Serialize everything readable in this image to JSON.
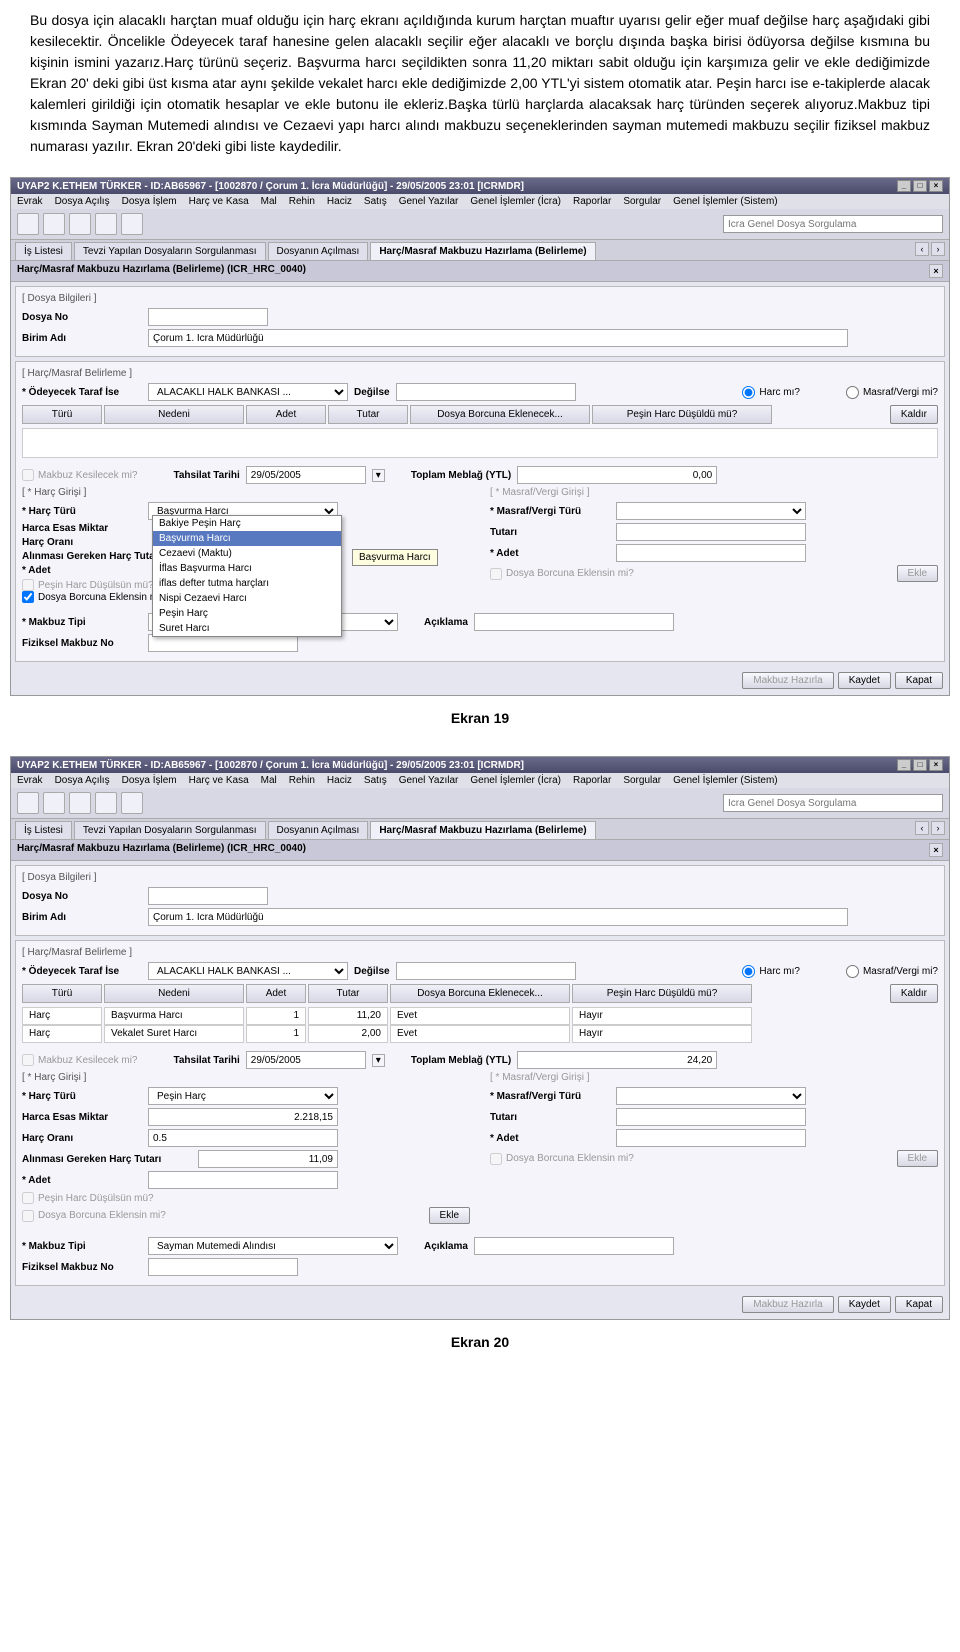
{
  "paragraph": "Bu dosya için alacaklı harçtan muaf olduğu için harç ekranı açıldığında kurum harçtan muaftır uyarısı gelir eğer muaf değilse harç aşağıdaki gibi kesilecektir. Öncelikle Ödeyecek taraf hanesine gelen alacaklı seçilir eğer alacaklı ve borçlu dışında başka birisi ödüyorsa değilse kısmına bu kişinin ismini yazarız.Harç türünü seçeriz. Başvurma harcı seçildikten sonra 11,20 miktarı sabit olduğu için karşımıza gelir ve ekle dediğimizde Ekran 20' deki gibi üst kısma atar aynı şekilde vekalet harcı ekle dediğimizde 2,00 YTL'yi sistem otomatik atar. Peşin harcı ise e-takiplerde alacak kalemleri girildiği için otomatik hesaplar ve ekle butonu ile ekleriz.Başka türlü harçlarda alacaksak harç türünden seçerek alıyoruz.Makbuz tipi kısmında Sayman Mutemedi alındısı ve Cezaevi yapı harcı alındı makbuzu seçeneklerinden sayman mutemedi makbuzu seçilir fiziksel makbuz numarası yazılır. Ekran 20'deki gibi liste kaydedilir.",
  "titlebar": "UYAP2  K.ETHEM TÜRKER - ID:AB65967 - [1002870 / Çorum 1. İcra Müdürlüğü] - 29/05/2005 23:01 [ICRMDR]",
  "menus": [
    "Evrak",
    "Dosya Açılış",
    "Dosya İşlem",
    "Harç ve Kasa",
    "Mal",
    "Rehin",
    "Haciz",
    "Satış",
    "Genel Yazılar",
    "Genel İşlemler (İcra)",
    "Raporlar",
    "Sorgular",
    "Genel İşlemler (Sistem)"
  ],
  "searchPlaceholder": "İcra Genel Dosya Sorgulama",
  "tabs": [
    "İş Listesi",
    "Tevzi Yapılan Dosyaların Sorgulanması",
    "Dosyanın Açılması",
    "Harç/Masraf Makbuzu Hazırlama (Belirleme)"
  ],
  "activeTab": 3,
  "subtitle": "Harç/Masraf Makbuzu Hazırlama (Belirleme) (ICR_HRC_0040)",
  "dosyaBilgileri": {
    "title": "[ Dosya Bilgileri ]",
    "dosyaNoLabel": "Dosya No",
    "birimAdiLabel": "Birim Adı",
    "birimAdi": "Çorum 1. İcra Müdürlüğü"
  },
  "harcBelirleme": {
    "title": "[ Harç/Masraf Belirleme ]",
    "odeyecekLabel": "* Ödeyecek Taraf İse",
    "odeyecekValue": "ALACAKLI HALK BANKASI ...",
    "degilseLabel": "Değilse",
    "harcMi": "Harc mı?",
    "masrafMi": "Masraf/Vergi mi?",
    "headers": [
      "Türü",
      "Nedeni",
      "Adet",
      "Tutar",
      "Dosya Borcuna Eklenecek...",
      "Peşin Harc Düşüldü mü?"
    ],
    "kaldirBtn": "Kaldır"
  },
  "tahsilat": {
    "makbuzKesilecek": "Makbuz Kesilecek mi?",
    "tahsilatTarihiLabel": "Tahsilat Tarihi",
    "tahsilatTarihi": "29/05/2005",
    "toplamLabel": "Toplam Meblağ (YTL)",
    "toplam1": "0,00",
    "toplam2": "24,20"
  },
  "harcGirisi": {
    "title": "[ * Harç Girişi ]",
    "harcTuruLabel": "* Harç Türü",
    "harcaEsasLabel": "Harca Esas Miktar",
    "harcOraniLabel": "Harç Oranı",
    "alinmasiGerekenLabel": "Alınması Gereken Harç Tutarı",
    "adetLabel": "* Adet",
    "pesinDusulsun": "Peşin Harc Düşülsün mü?",
    "dosyaBorcuna": "Dosya Borcuna Eklensin mi?",
    "ekleBtn": "Ekle",
    "dropdown": {
      "selected": "Başvurma Harcı",
      "options": [
        "Bakiye Peşin Harç",
        "Başvurma Harcı",
        "Cezaevi (Maktu)",
        "İflas Başvurma Harcı",
        "iflas defter tutma harçları",
        "Nispi Cezaevi Harcı",
        "Peşin Harç",
        "Suret Harcı"
      ],
      "tooltip": "Başvurma Harcı"
    }
  },
  "masrafGirisi": {
    "title": "[ * Masraf/Vergi Girişi ]",
    "turuLabel": "* Masraf/Vergi Türü",
    "tutariLabel": "Tutarı",
    "adetLabel": "* Adet",
    "dosyaBorcuna": "Dosya Borcuna Eklensin mi?",
    "ekleBtn": "Ekle"
  },
  "makbuz": {
    "tipiLabel": "* Makbuz Tipi",
    "tipiValue": "Sayman Mutemedi Alındısı",
    "fizikselLabel": "Fiziksel Makbuz No",
    "aciklamaLabel": "Açıklama"
  },
  "buttons": {
    "hazirla": "Makbuz Hazırla",
    "kaydet": "Kaydet",
    "kapat": "Kapat"
  },
  "caption1": "Ekran 19",
  "caption2": "Ekran 20",
  "ekran20": {
    "rows": [
      {
        "turu": "Harç",
        "nedeni": "Başvurma Harcı",
        "adet": "1",
        "tutar": "11,20",
        "ekl": "Evet",
        "pesin": "Hayır"
      },
      {
        "turu": "Harç",
        "nedeni": "Vekalet Suret Harcı",
        "adet": "1",
        "tutar": "2,00",
        "ekl": "Evet",
        "pesin": "Hayır"
      }
    ],
    "harcTuru": "Peşin Harç",
    "harcaEsas": "2.218,15",
    "harcOrani": "0.5",
    "alinmasi": "11,09"
  }
}
